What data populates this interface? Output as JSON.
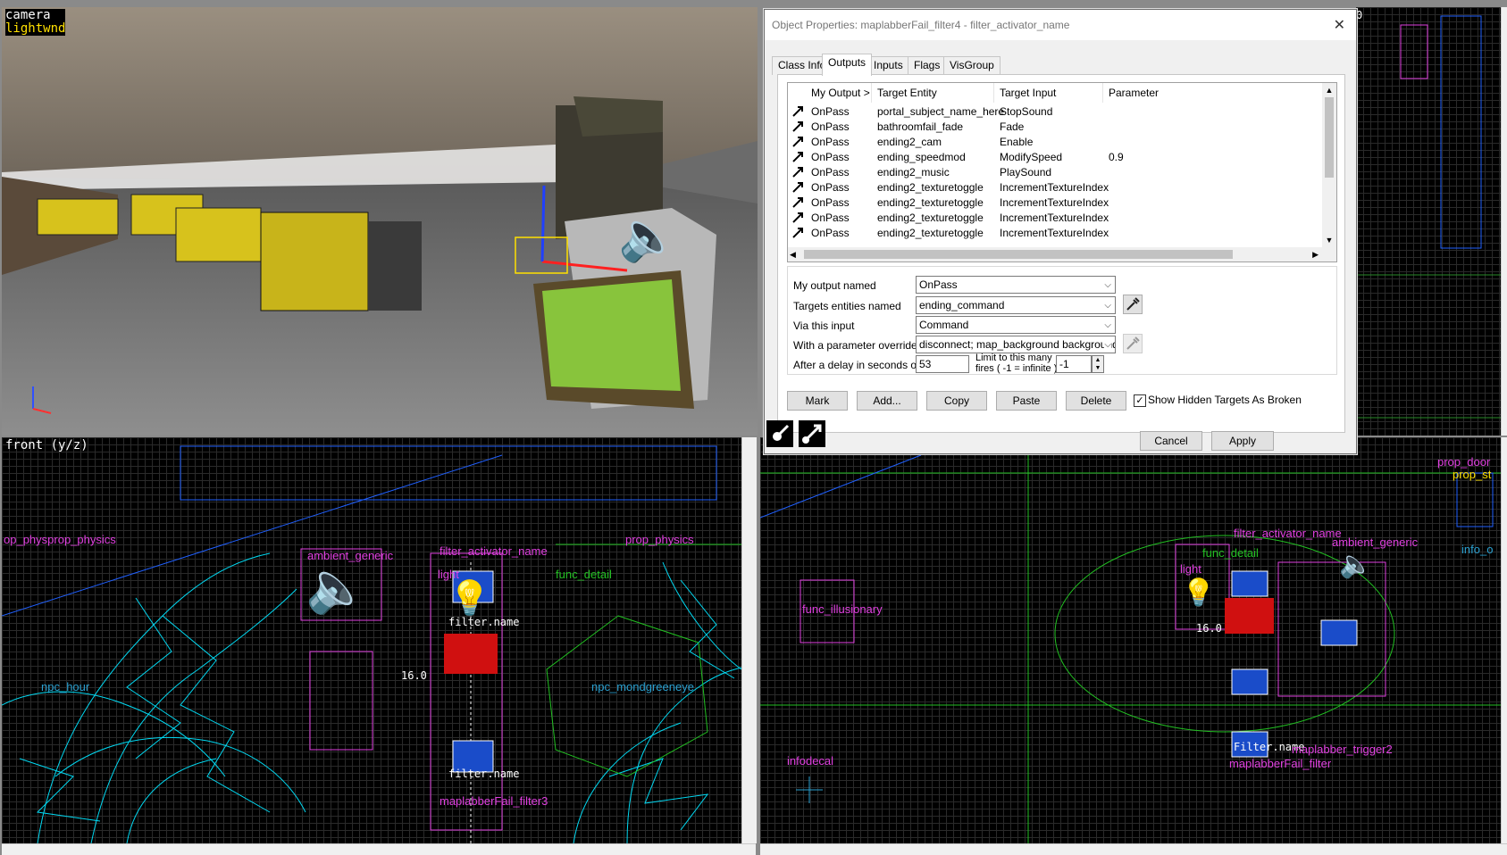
{
  "viewports": {
    "camera": {
      "label_line1": "camera",
      "label_line2": "lightwnd"
    },
    "front": {
      "label": "front (y/z)"
    }
  },
  "front_labels": {
    "prop_physics_left": "op_physprop_physics",
    "prop_physics_right": "prop_physics",
    "ambient_generic": "ambient_generic",
    "filter_activator_name": "filter_activator_name",
    "light": "light",
    "func_detail": "func_detail",
    "npc_hound": "npc_hour",
    "npc_right": "npc_mondgreeneye",
    "size_value": "16.0",
    "filter_name_a": "filter.name",
    "filter_name_b": "filter.name",
    "maplabber": "maplabberFail_filter3"
  },
  "side_labels": {
    "filter_activator_name": "filter_activator_name",
    "ambient_generic": "ambient_generic",
    "func_detail": "func_detail",
    "light": "light",
    "func_illusionary": "func_illusionary",
    "size_value": "16.0",
    "maplabber_fail": "maplabberFail_filter",
    "maplabber_trigger": "maplabber_trigger2",
    "infodecal": "infodecal",
    "prop_door": "prop_door",
    "prop_st": "prop_st",
    "info_o": "info_o",
    "filter_name": "Filter.name",
    "corner_value": "0"
  },
  "dialog": {
    "title": "Object Properties: maplabberFail_filter4 - filter_activator_name",
    "close_glyph": "✕",
    "tabs": [
      "Class Info",
      "Outputs",
      "Inputs",
      "Flags",
      "VisGroup"
    ],
    "active_tab": "Outputs",
    "columns": [
      "My Output  >",
      "Target Entity",
      "Target Input",
      "Parameter"
    ],
    "rows": [
      {
        "output": "OnPass",
        "target": "portal_subject_name_here",
        "input": "StopSound",
        "param": ""
      },
      {
        "output": "OnPass",
        "target": "bathroomfail_fade",
        "input": "Fade",
        "param": ""
      },
      {
        "output": "OnPass",
        "target": "ending2_cam",
        "input": "Enable",
        "param": ""
      },
      {
        "output": "OnPass",
        "target": "ending_speedmod",
        "input": "ModifySpeed",
        "param": "0.9"
      },
      {
        "output": "OnPass",
        "target": "ending2_music",
        "input": "PlaySound",
        "param": ""
      },
      {
        "output": "OnPass",
        "target": "ending2_texturetoggle",
        "input": "IncrementTextureIndex",
        "param": ""
      },
      {
        "output": "OnPass",
        "target": "ending2_texturetoggle",
        "input": "IncrementTextureIndex",
        "param": ""
      },
      {
        "output": "OnPass",
        "target": "ending2_texturetoggle",
        "input": "IncrementTextureIndex",
        "param": ""
      },
      {
        "output": "OnPass",
        "target": "ending2_texturetoggle",
        "input": "IncrementTextureIndex",
        "param": ""
      }
    ],
    "form": {
      "output_named_label": "My output named",
      "output_named_value": "OnPass",
      "targets_label": "Targets entities named",
      "targets_value": "ending_command",
      "via_input_label": "Via this input",
      "via_input_value": "Command",
      "param_label": "With a parameter override of",
      "param_value": "disconnect; map_background background",
      "delay_label": "After a delay in seconds of",
      "delay_value": "53",
      "limit_label_1": "Limit to this many",
      "limit_label_2": "fires ( -1 = infinite )",
      "limit_value": "-1"
    },
    "buttons": {
      "mark": "Mark",
      "add": "Add...",
      "copy": "Copy",
      "paste": "Paste",
      "delete": "Delete",
      "show_hidden": "Show Hidden Targets As Broken",
      "cancel": "Cancel",
      "apply": "Apply"
    },
    "show_hidden_checked": true
  },
  "icons": [
    "output-connection-icon",
    "eyedropper-icon",
    "scroll-arrow-icon",
    "speaker-icon",
    "lightbulb-icon"
  ],
  "colors": {
    "entity_label": "#e040e0",
    "wire_cyan": "#00e5ff",
    "detail_green": "#22c022",
    "grid_blue": "#1f4f7a"
  }
}
